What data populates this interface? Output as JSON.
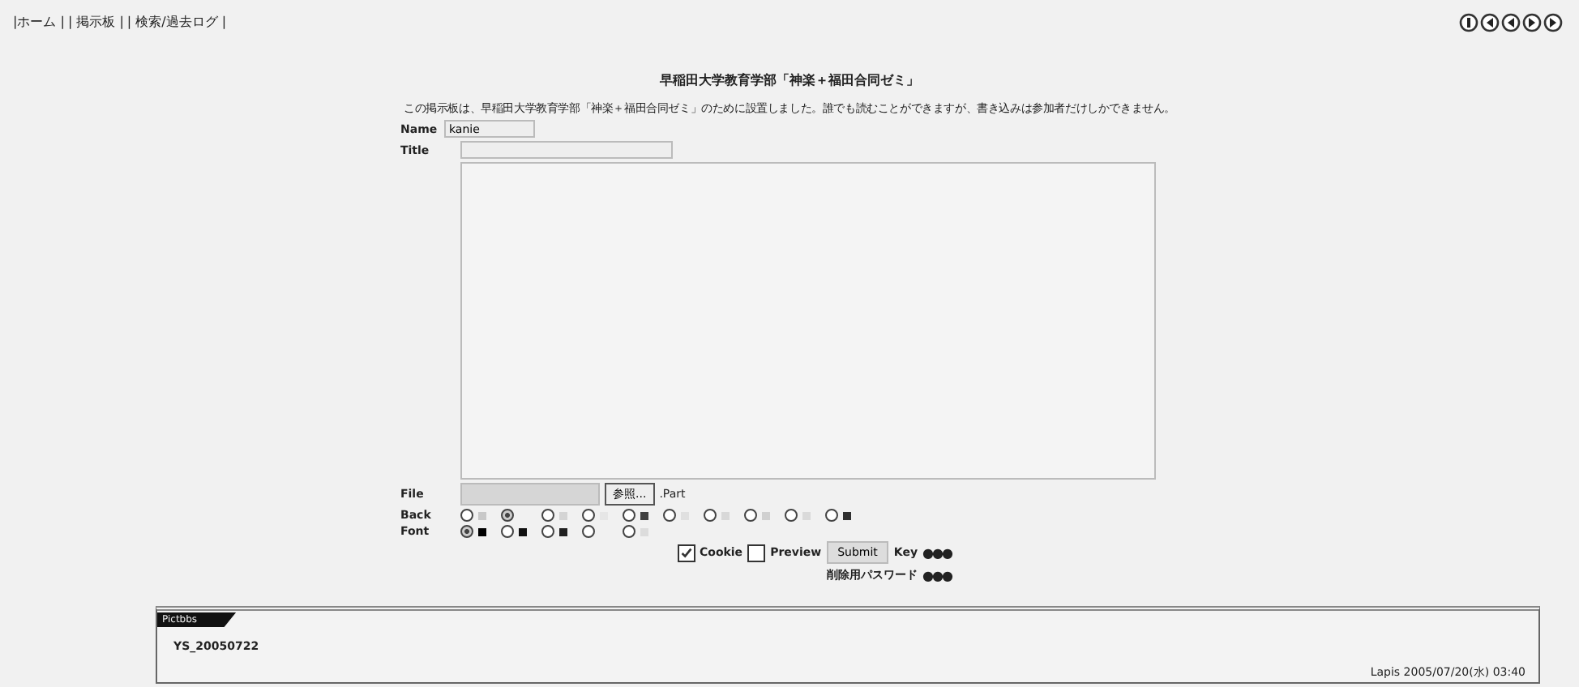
{
  "nav": {
    "links": [
      "|ホーム |",
      "| 掲示板 |",
      "| 検索/過去ログ |"
    ]
  },
  "title": "早稲田大学教育学部「神楽＋福田合同ゼミ」",
  "description": "この掲示板は、早稲田大学教育学部「神楽＋福田合同ゼミ」のために設置しました。誰でも読むことができますが、書き込みは参加者だけしかできません。",
  "form": {
    "name_label": "Name",
    "name_value": "kanie",
    "title_label": "Title",
    "file_label": "File",
    "browse_button": "参照...",
    "part_label": ".Part",
    "back_label": "Back",
    "back_options": [
      {
        "selected": false,
        "color": "#c8c8c8"
      },
      {
        "selected": true
      },
      {
        "selected": false,
        "color": "#d4d4d4"
      },
      {
        "selected": false,
        "color": "#e6e6e6"
      },
      {
        "selected": false,
        "color": "#404040"
      },
      {
        "selected": false,
        "color": "#e0e0e0"
      },
      {
        "selected": false,
        "color": "#d8d8d8"
      },
      {
        "selected": false,
        "color": "#d0d0d0"
      },
      {
        "selected": false,
        "color": "#dadada"
      },
      {
        "selected": false,
        "color": "#303030"
      }
    ],
    "font_label": "Font",
    "font_options": [
      {
        "selected": true,
        "color": "#000000"
      },
      {
        "selected": false,
        "color": "#101010"
      },
      {
        "selected": false,
        "color": "#202020"
      },
      {
        "selected": false
      },
      {
        "selected": false,
        "color": "#dcdcdc"
      }
    ],
    "cookie": {
      "label": "Cookie",
      "checked": true
    },
    "preview": {
      "label": "Preview",
      "checked": false
    },
    "submit_button": "Submit",
    "key_label": "Key",
    "key_value": "●●●",
    "delete_label": "削除用パスワード",
    "delete_value": "●●●"
  },
  "post": {
    "tab": "Pictbbs",
    "text": "YS_20050722",
    "footer": "Lapis 2005/07/20(水) 03:40"
  }
}
